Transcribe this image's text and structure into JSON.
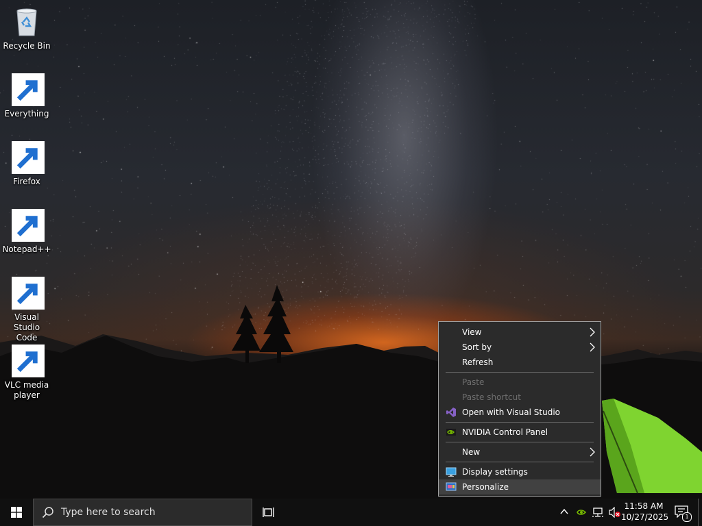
{
  "desktop_icons": [
    {
      "label": "Recycle Bin",
      "icon": "recycle-bin-icon"
    },
    {
      "label": "Everything",
      "icon": "everything-search-icon"
    },
    {
      "label": "Firefox",
      "icon": "firefox-icon"
    },
    {
      "label": "Notepad++",
      "icon": "notepad-plus-plus-icon"
    },
    {
      "label": "Visual Studio\nCode",
      "icon": "vscode-icon"
    },
    {
      "label": "VLC media\nplayer",
      "icon": "vlc-icon"
    }
  ],
  "context_menu": {
    "items": [
      {
        "label": "View",
        "submenu": true,
        "enabled": true
      },
      {
        "label": "Sort by",
        "submenu": true,
        "enabled": true
      },
      {
        "label": "Refresh",
        "enabled": true
      },
      {
        "label": "Paste",
        "enabled": false
      },
      {
        "label": "Paste shortcut",
        "enabled": false
      },
      {
        "label": "Open with Visual Studio",
        "icon": "visual-studio-icon",
        "enabled": true
      },
      {
        "label": "NVIDIA Control Panel",
        "icon": "nvidia-icon",
        "enabled": true
      },
      {
        "label": "New",
        "submenu": true,
        "enabled": true
      },
      {
        "label": "Display settings",
        "icon": "display-settings-icon",
        "enabled": true
      },
      {
        "label": "Personalize",
        "icon": "personalize-icon",
        "enabled": true,
        "highlighted": true
      }
    ]
  },
  "taskbar": {
    "search_placeholder": "Type here to search",
    "clock_time": "11:58 AM",
    "clock_date": "10/27/2025",
    "notification_count": "1"
  },
  "colors": {
    "menu_bg": "#2b2b2b",
    "menu_hover": "#414141",
    "taskbar_bg": "#101010",
    "vscode_blue": "#1f8ad2",
    "vlc_orange": "#f08a00",
    "nvidia_green": "#76b900",
    "visual_studio_purple": "#8661c5"
  }
}
